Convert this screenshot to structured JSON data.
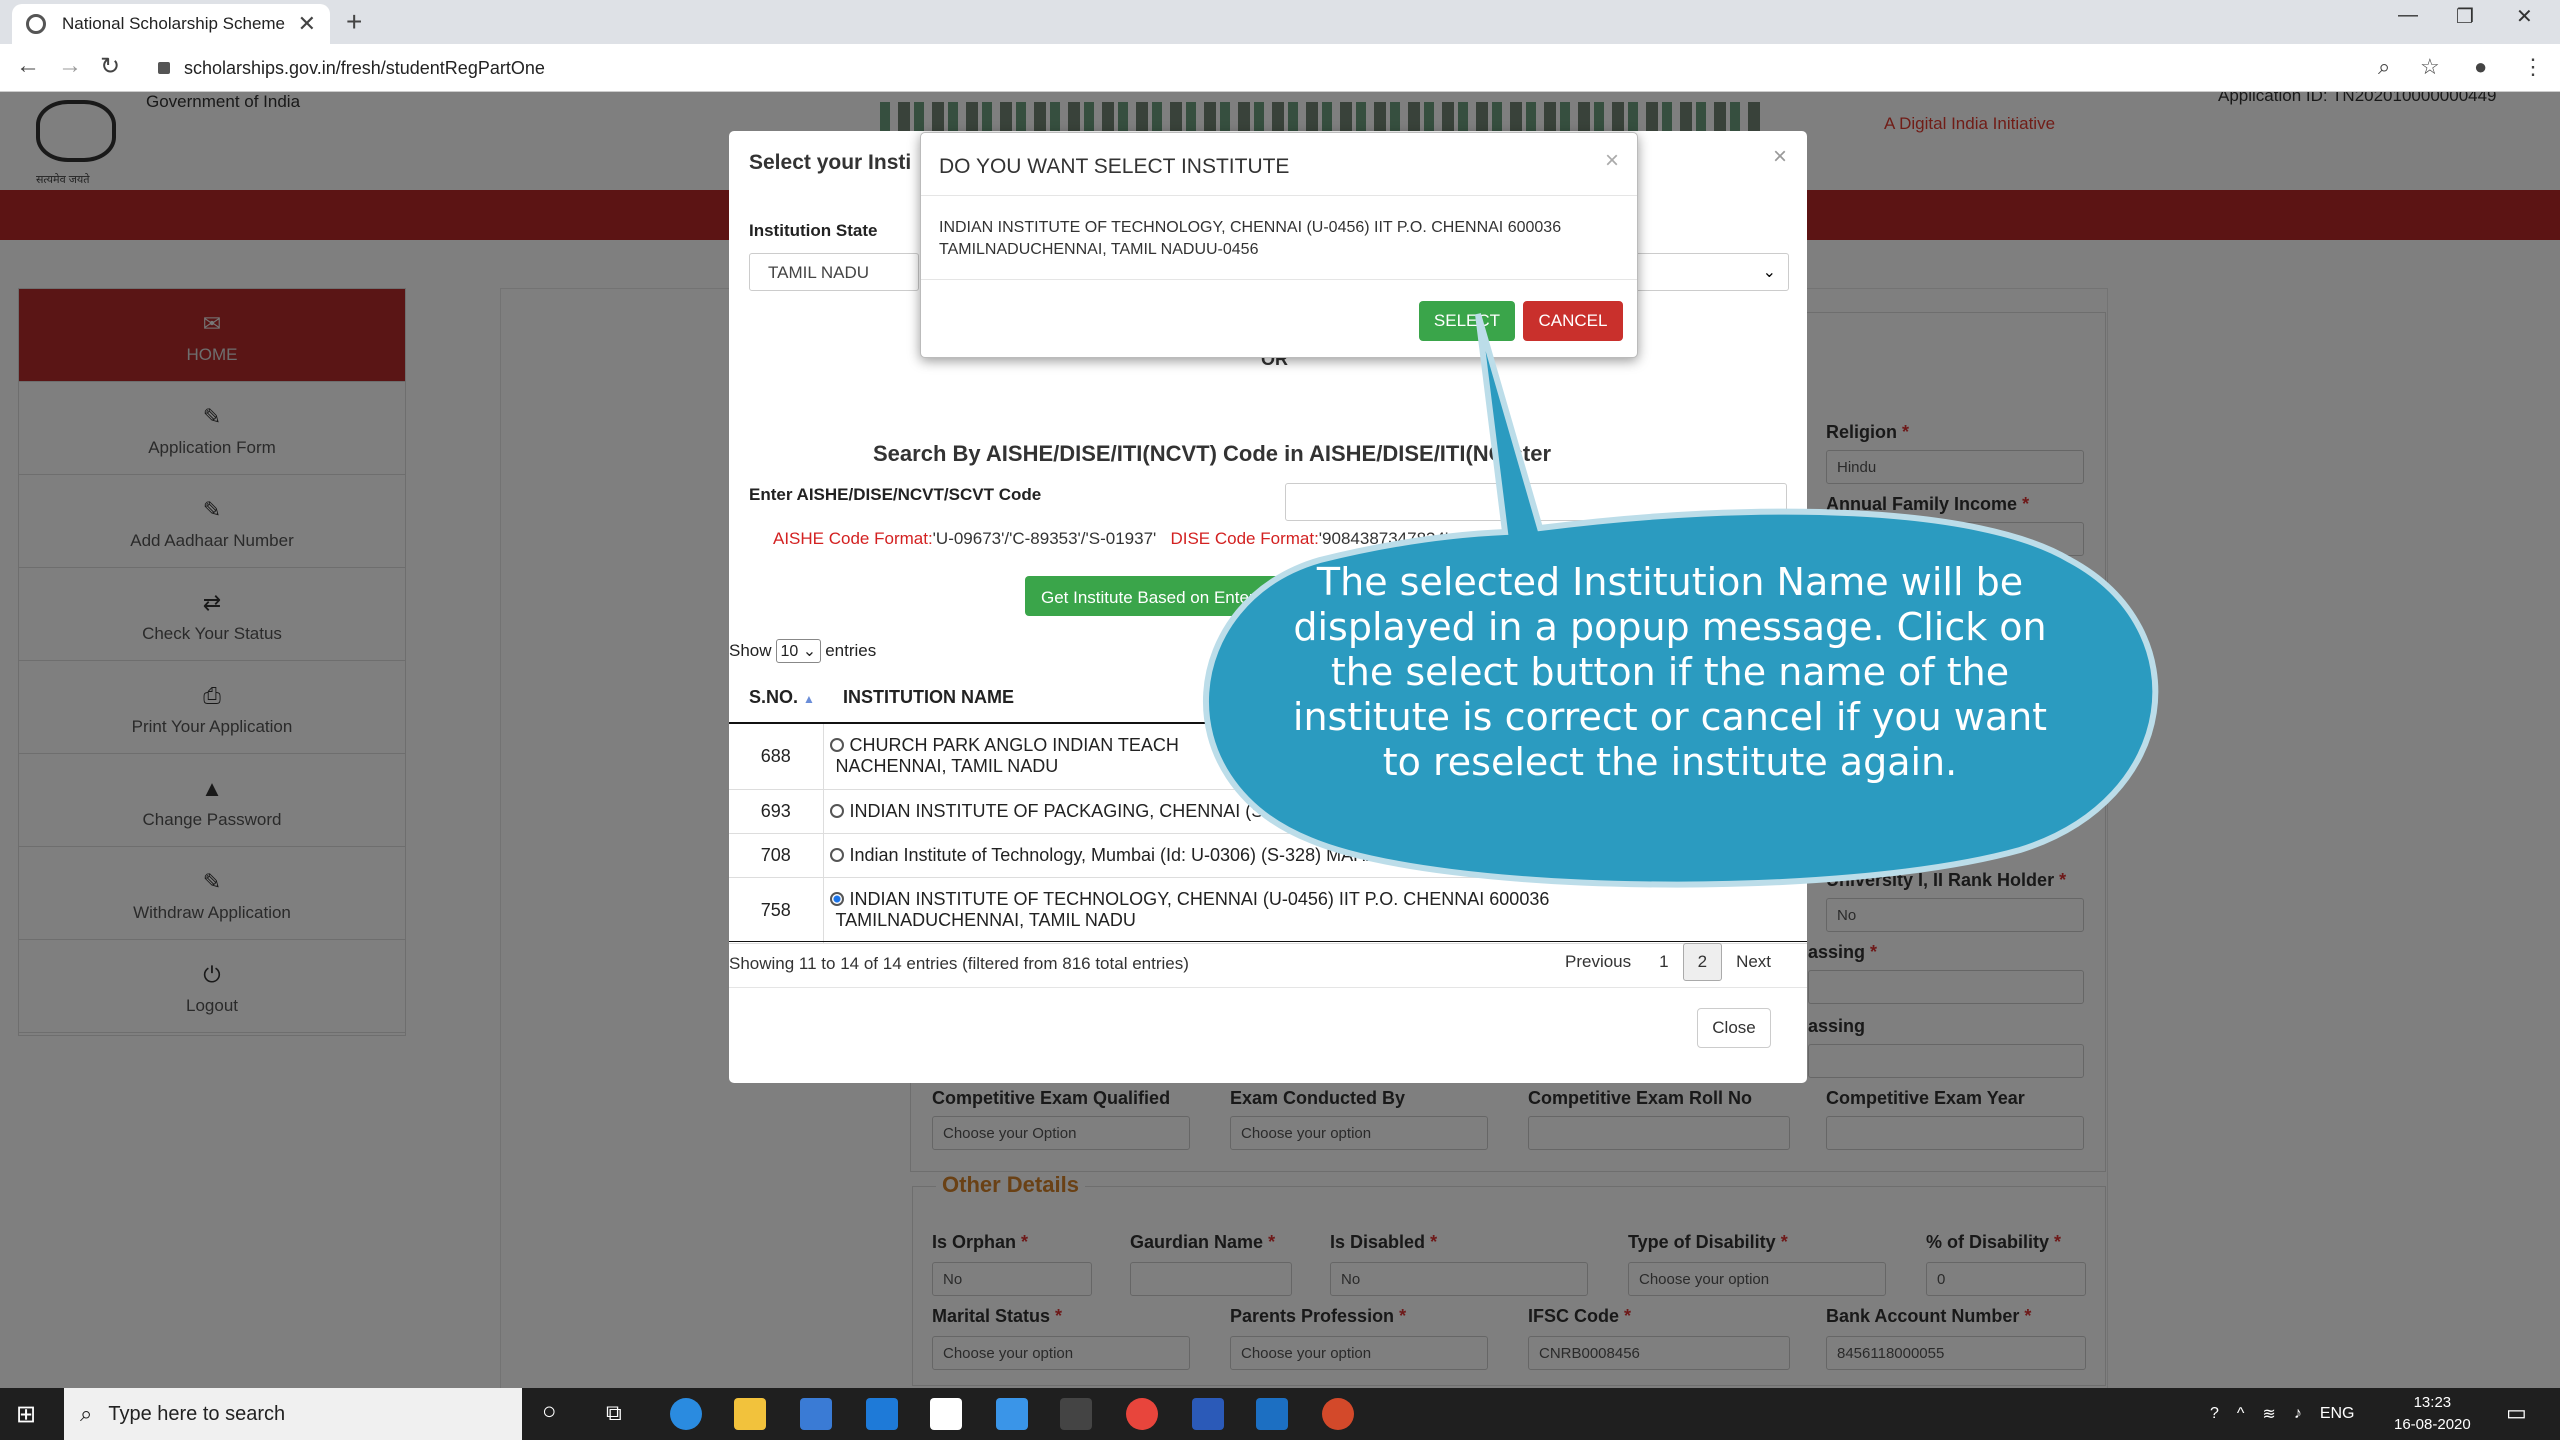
{
  "browser": {
    "tab_title": "National Scholarship Scheme",
    "url": "scholarships.gov.in/fresh/studentRegPartOne"
  },
  "header": {
    "gov": "Government of India",
    "emblem_text": "सत्यमेव जयते",
    "digital_india": "A Digital India Initiative",
    "application_id": "Application ID: TN202010000000449"
  },
  "sidebar": {
    "items": [
      {
        "label": "HOME",
        "icon": "envelope-icon"
      },
      {
        "label": "Application Form",
        "icon": "edit-icon"
      },
      {
        "label": "Add Aadhaar Number",
        "icon": "edit-icon"
      },
      {
        "label": "Check Your Status",
        "icon": "exchange-icon"
      },
      {
        "label": "Print Your Application",
        "icon": "print-icon"
      },
      {
        "label": "Change Password",
        "icon": "lock-icon"
      },
      {
        "label": "Withdraw Application",
        "icon": "edit-icon"
      },
      {
        "label": "Logout",
        "icon": "power-icon"
      }
    ]
  },
  "form": {
    "religion_label": "Religion",
    "religion_value": "Hindu",
    "income_label": "Annual Family Income",
    "rank_label": "University I, II Rank Holder",
    "rank_value": "No",
    "passing1": "assing",
    "passing2": "assing",
    "cexam_label": "Competitive Exam Qualified",
    "cexam_value": "Choose your Option",
    "cond_label": "Exam Conducted By",
    "cond_value": "Choose your option",
    "roll_label": "Competitive Exam Roll No",
    "year_label": "Competitive Exam Year",
    "other_legend": "Other Details",
    "orphan_label": "Is Orphan",
    "orphan_value": "No",
    "guardian_label": "Gaurdian Name",
    "disabled_label": "Is Disabled",
    "disabled_value": "No",
    "disability_type_label": "Type of Disability",
    "disability_type_value": "Choose your option",
    "disability_pct_label": "% of Disability",
    "disability_pct_value": "0",
    "marital_label": "Marital Status",
    "marital_value": "Choose your option",
    "parents_label": "Parents Profession",
    "parents_value": "Choose your option",
    "ifsc_label": "IFSC Code",
    "ifsc_value": "CNRB0008456",
    "bank_label": "Bank Account Number",
    "bank_value": "8456118000055"
  },
  "modal": {
    "title": "Select your Insti",
    "state_label": "Institution State",
    "state_value": "TAMIL NADU",
    "or": "OR",
    "search_heading": "Search By AISHE/DISE/ITI(NCVT) Code in AISHE/DISE/ITI(NC                  ster",
    "code_label": "Enter AISHE/DISE/NCVT/SCVT Code",
    "aishe_fmt_label": "AISHE Code Format:",
    "aishe_fmt_value": "'U-09673'/'C-89353'/'S-01937'",
    "dise_fmt_label": "DISE Code Format:",
    "dise_fmt_value": "'9084387347834'",
    "get_button": "Get Institute Based on Entered A",
    "show_label": "Show",
    "show_value": "10",
    "entries_label": "entries",
    "col_sno": "S.NO.",
    "col_name": "INSTITUTION NAME",
    "rows": [
      {
        "sno": "688",
        "name": "CHURCH PARK ANGLO INDIAN TEACH",
        "name2": "NACHENNAI, TAMIL NADU"
      },
      {
        "sno": "693",
        "name": "INDIAN INSTITUTE OF PACKAGING, CHENNAI (S"
      },
      {
        "sno": "708",
        "name": "Indian Institute of Technology, Mumbai (Id: U-0306) (S-328) MAHA"
      },
      {
        "sno": "758",
        "name": "INDIAN INSTITUTE OF TECHNOLOGY, CHENNAI (U-0456) IIT P.O. CHENNAI 600036",
        "name2": "TAMILNADUCHENNAI, TAMIL NADU"
      }
    ],
    "info": "Showing 11 to 14 of 14 entries (filtered from 816 total entries)",
    "prev": "Previous",
    "page1": "1",
    "page2": "2",
    "next": "Next",
    "close": "Close"
  },
  "confirm": {
    "title": "DO YOU WANT SELECT INSTITUTE",
    "body": "INDIAN INSTITUTE OF TECHNOLOGY, CHENNAI (U-0456) IIT P.O. CHENNAI 600036 TAMILNADUCHENNAI, TAMIL NADUU-0456",
    "select": "SELECT",
    "cancel": "CANCEL"
  },
  "callout": {
    "text": "The selected Institution Name  will be displayed in a popup message. Click on the select button if the name of the institute is correct or cancel if you want to reselect the institute again."
  },
  "taskbar": {
    "search_placeholder": "Type here to search",
    "lang": "ENG",
    "time": "13:23",
    "date": "16-08-2020"
  },
  "colors": {
    "brand_red": "#b92828",
    "button_green": "#3aa54a",
    "cancel_red": "#c9302c",
    "callout_blue": "#2b9bc0"
  }
}
